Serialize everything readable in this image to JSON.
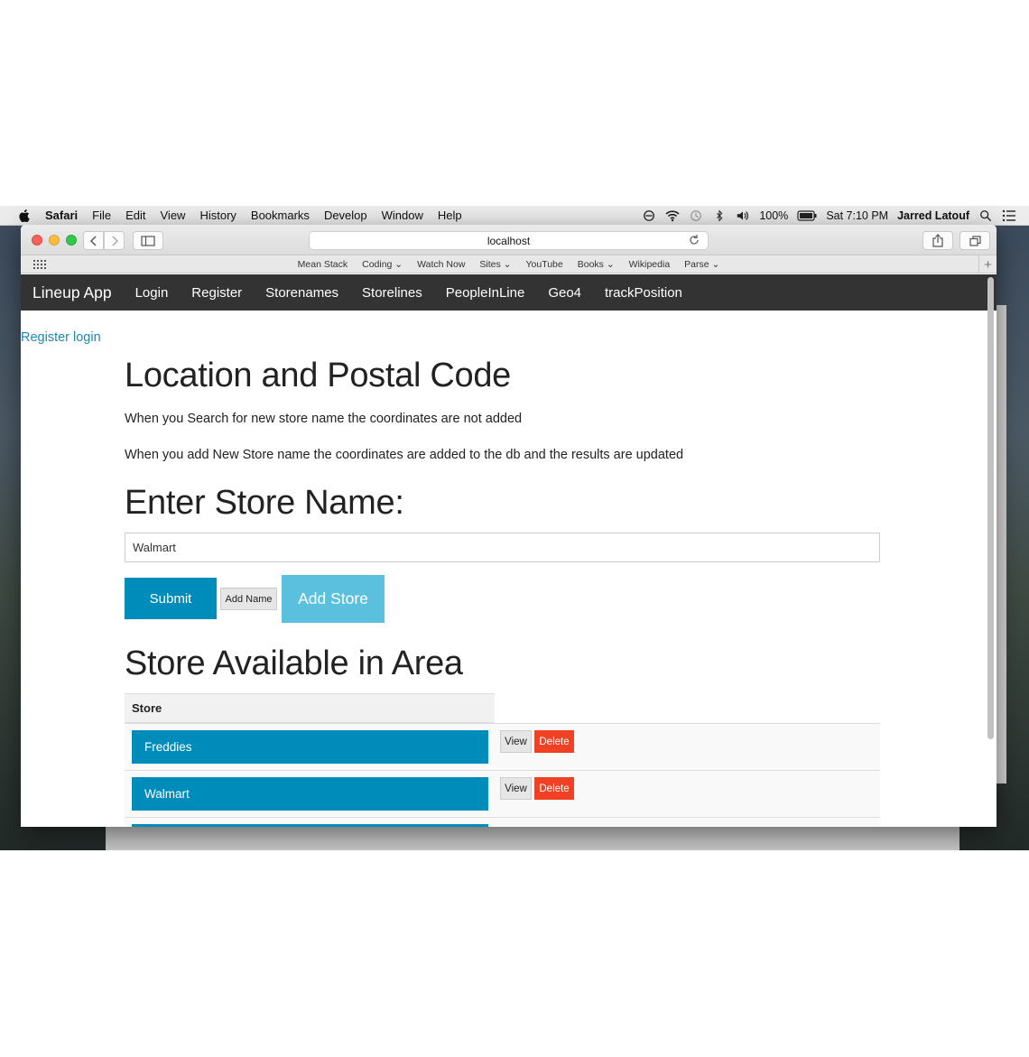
{
  "menubar": {
    "items": [
      "Safari",
      "File",
      "Edit",
      "View",
      "History",
      "Bookmarks",
      "Develop",
      "Window",
      "Help"
    ],
    "battery": "100%",
    "clock": "Sat 7:10 PM",
    "user": "Jarred Latouf"
  },
  "browser": {
    "url": "localhost",
    "bookmarks": [
      "Mean Stack",
      "Coding ⌄",
      "Watch Now",
      "Sites ⌄",
      "YouTube",
      "Books ⌄",
      "Wikipedia",
      "Parse ⌄"
    ]
  },
  "navbar": {
    "brand": "Lineup App",
    "links": [
      "Login",
      "Register",
      "Storenames",
      "Storelines",
      "PeopleInLine",
      "Geo4",
      "trackPosition"
    ]
  },
  "page": {
    "register_login": "Register login",
    "heading1": "Location and Postal Code",
    "note1": "When you Search for new store name the coordinates are not added",
    "note2": "When you add New Store name the coordinates are added to the db and the results are updated",
    "heading2": "Enter Store Name:",
    "store_input_value": "Walmart",
    "submit_label": "Submit",
    "add_name_label": "Add Name",
    "add_store_label": "Add Store",
    "heading3": "Store Available in Area",
    "table_header": "Store",
    "stores": [
      {
        "name": "Freddies",
        "view": "View",
        "delete": "Delete"
      },
      {
        "name": "Walmart",
        "view": "View",
        "delete": "Delete"
      }
    ]
  },
  "colors": {
    "navbar": "#333333",
    "primary": "#008cba",
    "info": "#5bc0de",
    "alert": "#f04124",
    "link": "#1a8ab4"
  }
}
